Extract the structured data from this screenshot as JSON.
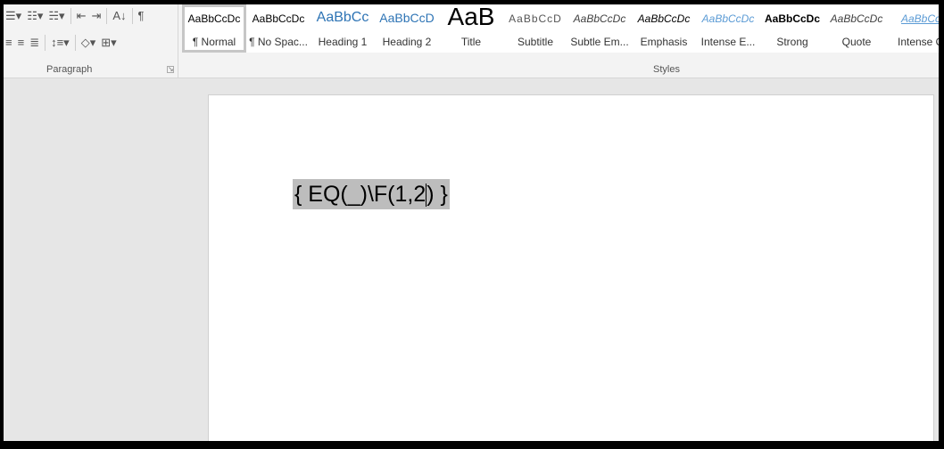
{
  "ribbon": {
    "paragraph": {
      "label": "Paragraph",
      "row1_icons": [
        "bullets-icon",
        "numbering-icon",
        "multilevel-list-icon",
        "decrease-indent-icon",
        "increase-indent-icon",
        "sort-icon",
        "show-formatting-icon"
      ],
      "row2_icons": [
        "align-center-icon",
        "align-right-icon",
        "justify-icon",
        "line-spacing-icon",
        "shading-icon",
        "borders-icon"
      ]
    },
    "styles": {
      "label": "Styles",
      "items": [
        {
          "preview": "AaBbCcDc",
          "label": "¶ Normal",
          "selected": true
        },
        {
          "preview": "AaBbCcDc",
          "label": "¶ No Spac..."
        },
        {
          "preview": "AaBbCc",
          "label": "Heading 1"
        },
        {
          "preview": "AaBbCcD",
          "label": "Heading 2"
        },
        {
          "preview": "AaB",
          "label": "Title"
        },
        {
          "preview": "AaBbCcD",
          "label": "Subtitle"
        },
        {
          "preview": "AaBbCcDc",
          "label": "Subtle Em..."
        },
        {
          "preview": "AaBbCcDc",
          "label": "Emphasis"
        },
        {
          "preview": "AaBbCcDc",
          "label": "Intense E..."
        },
        {
          "preview": "AaBbCcDc",
          "label": "Strong"
        },
        {
          "preview": "AaBbCcDc",
          "label": "Quote"
        },
        {
          "preview": "AaBbCc",
          "label": "Intense Q"
        }
      ]
    }
  },
  "document": {
    "field_before": "{ EQ(_)\\F(1,2",
    "field_after": ") }"
  }
}
